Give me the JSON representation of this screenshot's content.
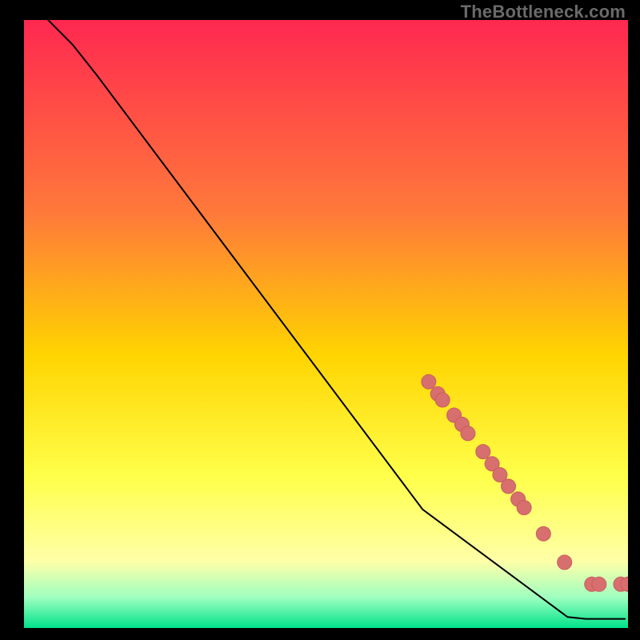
{
  "watermark": "TheBottleneck.com",
  "colors": {
    "curve": "#000000",
    "marker_fill": "#d76f6f",
    "marker_stroke": "#c95d5d",
    "bg_black": "#000000",
    "grad_top": "#ff2850",
    "grad_mid1": "#ff7a3a",
    "grad_mid2": "#ffd400",
    "grad_yellow": "#ffff4a",
    "grad_pale": "#ffffa8",
    "grad_green1": "#9effc0",
    "grad_green2": "#00e28a"
  },
  "chart_data": {
    "type": "line",
    "title": "",
    "xlabel": "",
    "ylabel": "",
    "xlim": [
      0,
      100
    ],
    "ylim": [
      0,
      100
    ],
    "curve": [
      {
        "x": 4,
        "y": 100
      },
      {
        "x": 8,
        "y": 96
      },
      {
        "x": 12,
        "y": 91
      },
      {
        "x": 66,
        "y": 19.5
      },
      {
        "x": 90,
        "y": 1.8
      },
      {
        "x": 93,
        "y": 1.5
      },
      {
        "x": 96,
        "y": 1.5
      },
      {
        "x": 99.5,
        "y": 1.5
      }
    ],
    "markers": [
      {
        "x": 67,
        "y": 40.5
      },
      {
        "x": 68.5,
        "y": 38.5
      },
      {
        "x": 69.3,
        "y": 37.5
      },
      {
        "x": 71.2,
        "y": 35
      },
      {
        "x": 72.5,
        "y": 33.5
      },
      {
        "x": 73.5,
        "y": 32
      },
      {
        "x": 76,
        "y": 29
      },
      {
        "x": 77.5,
        "y": 27
      },
      {
        "x": 78.8,
        "y": 25.2
      },
      {
        "x": 80.2,
        "y": 23.3
      },
      {
        "x": 81.8,
        "y": 21.2
      },
      {
        "x": 82.8,
        "y": 19.8
      },
      {
        "x": 86,
        "y": 15.5
      },
      {
        "x": 89.5,
        "y": 10.8
      },
      {
        "x": 94,
        "y": 7.2
      },
      {
        "x": 95.2,
        "y": 7.2
      },
      {
        "x": 98.8,
        "y": 7.2
      },
      {
        "x": 100,
        "y": 7.2
      }
    ]
  }
}
